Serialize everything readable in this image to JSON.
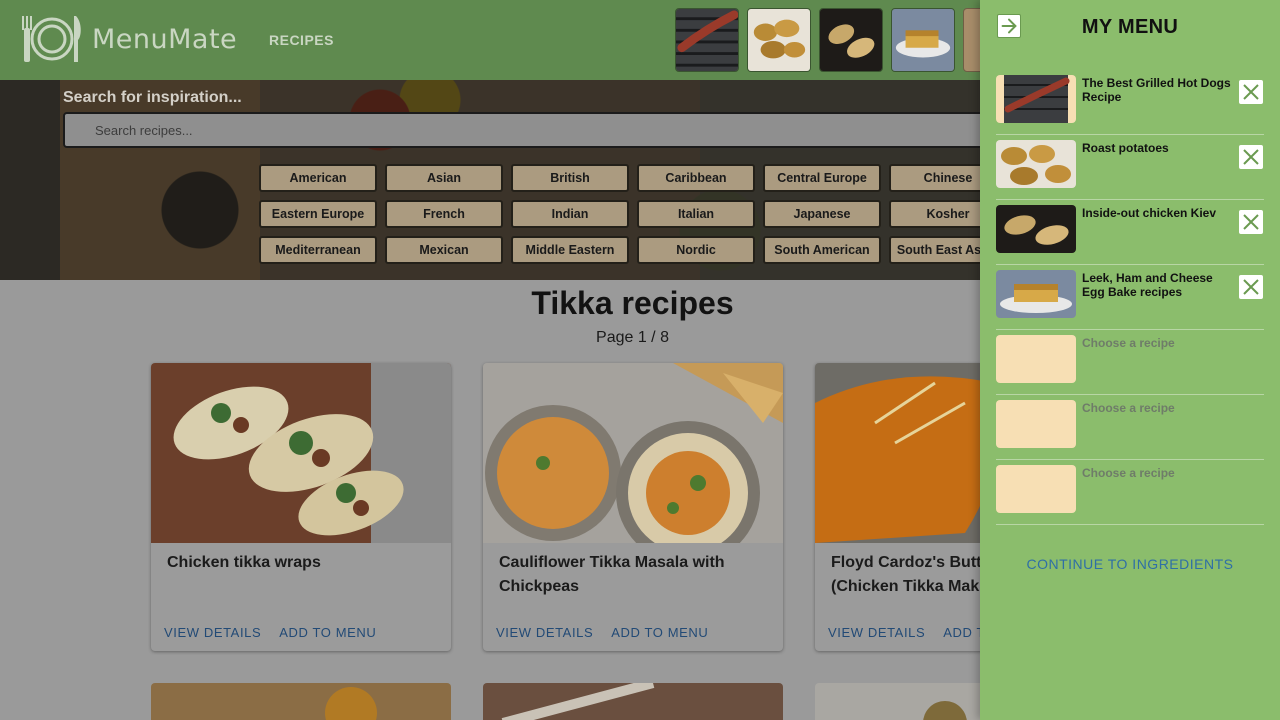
{
  "header": {
    "app_name": "MenuMate",
    "nav": [
      {
        "label": "RECIPES"
      }
    ],
    "menu_thumbs": [
      "sausage",
      "potatoes",
      "kiev",
      "eggbake",
      "empty"
    ]
  },
  "hero": {
    "search_title": "Search for inspiration...",
    "search_placeholder": "Search recipes...",
    "cuisines": [
      "American",
      "Asian",
      "British",
      "Caribbean",
      "Central Europe",
      "Chinese",
      "Eastern Europe",
      "French",
      "Indian",
      "Italian",
      "Japanese",
      "Kosher",
      "Mediterranean",
      "Mexican",
      "Middle Eastern",
      "Nordic",
      "South American",
      "South East Asian"
    ]
  },
  "main": {
    "title": "Tikka recipes",
    "page": "Page 1 / 8",
    "cards": [
      {
        "title": "Chicken tikka wraps",
        "view": "VIEW DETAILS",
        "add": "ADD TO MENU"
      },
      {
        "title": "Cauliflower Tikka Masala with Chickpeas",
        "view": "VIEW DETAILS",
        "add": "ADD TO MENU"
      },
      {
        "title": "Floyd Cardoz's Butter Chicken (Chicken Tikka Makhani)",
        "view": "VIEW DETAILS",
        "add": "ADD TO MENU"
      }
    ]
  },
  "drawer": {
    "title": "MY MENU",
    "items": [
      {
        "label": "The Best Grilled Hot Dogs Recipe",
        "image": "sausage-icon",
        "filled": true
      },
      {
        "label": "Roast potatoes",
        "image": "potatoes-icon",
        "filled": true
      },
      {
        "label": "Inside-out chicken Kiev",
        "image": "kiev-icon",
        "filled": true
      },
      {
        "label": "Leek, Ham and Cheese Egg Bake recipes",
        "image": "eggbake-icon",
        "filled": true
      },
      {
        "label": "Choose a recipe",
        "filled": false
      },
      {
        "label": "Choose a recipe",
        "filled": false
      },
      {
        "label": "Choose a recipe",
        "filled": false
      }
    ],
    "continue_label": "CONTINUE TO INGREDIENTS"
  },
  "colors": {
    "header": "#5f8a4f",
    "drawer": "#8bbd6c",
    "link": "#224a76",
    "cuisine_chip": "#ab9b80",
    "empty_slot": "#f7dfb4"
  }
}
